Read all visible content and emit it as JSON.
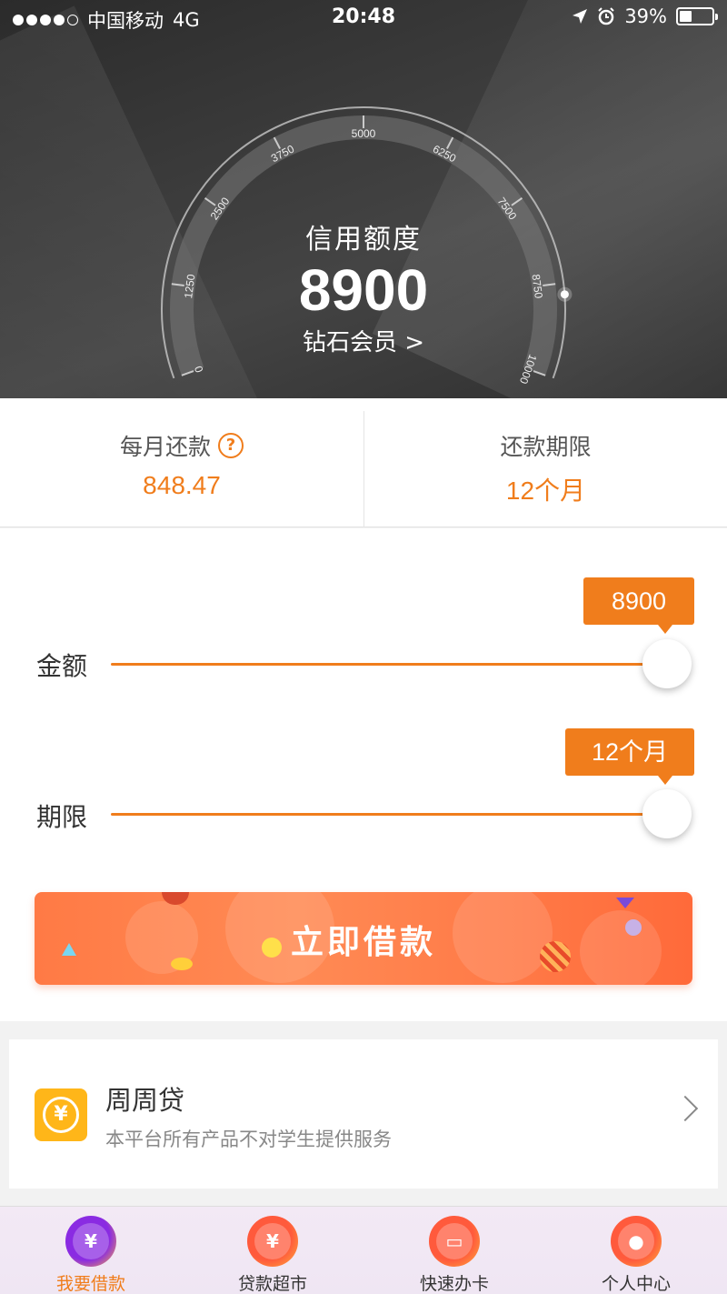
{
  "status_bar": {
    "carrier": "中国移动",
    "network": "4G",
    "time": "20:48",
    "battery": "39%",
    "battery_level": 0.39,
    "icons": [
      "signal-dots-icon",
      "location-arrow-icon",
      "alarm-icon",
      "battery-icon"
    ]
  },
  "gauge": {
    "title": "信用额度",
    "value": "8900",
    "member_link": "钻石会员 >",
    "ticks": [
      "0",
      "1250",
      "2500",
      "3750",
      "5000",
      "6250",
      "7500",
      "8750",
      "10000"
    ],
    "min": 0,
    "max": 10000,
    "current": 8900
  },
  "summary": {
    "monthly_label": "每月还款",
    "monthly_value": "848.47",
    "term_label": "还款期限",
    "term_value": "12个月",
    "help_icon": "question-circle-icon"
  },
  "sliders": {
    "amount_label": "金额",
    "amount_tip": "8900",
    "amount_level": 1.0,
    "term_label": "期限",
    "term_tip": "12个月",
    "term_level": 1.0
  },
  "borrow_button": {
    "label": "立即借款"
  },
  "product": {
    "name": "周周贷",
    "desc": "本平台所有产品不对学生提供服务",
    "logo_icon": "yen-coin-icon",
    "logo_glyph": "¥",
    "chevron_icon": "chevron-right-icon"
  },
  "tabs": [
    {
      "label": "我要借款",
      "icon": "borrow-yen-icon",
      "glyph": "¥",
      "active": true,
      "color": "#8a2be2"
    },
    {
      "label": "贷款超市",
      "icon": "loan-market-icon",
      "glyph": "¥",
      "active": false,
      "color": "#ff5a3c"
    },
    {
      "label": "快速办卡",
      "icon": "credit-card-icon",
      "glyph": "▭",
      "active": false,
      "color": "#ff5a3c"
    },
    {
      "label": "个人中心",
      "icon": "user-profile-icon",
      "glyph": "●",
      "active": false,
      "color": "#ff5a3c"
    }
  ],
  "colors": {
    "accent": "#f07d1c",
    "hero_bg": "#333333",
    "tab_bg": "#efe6f3"
  }
}
